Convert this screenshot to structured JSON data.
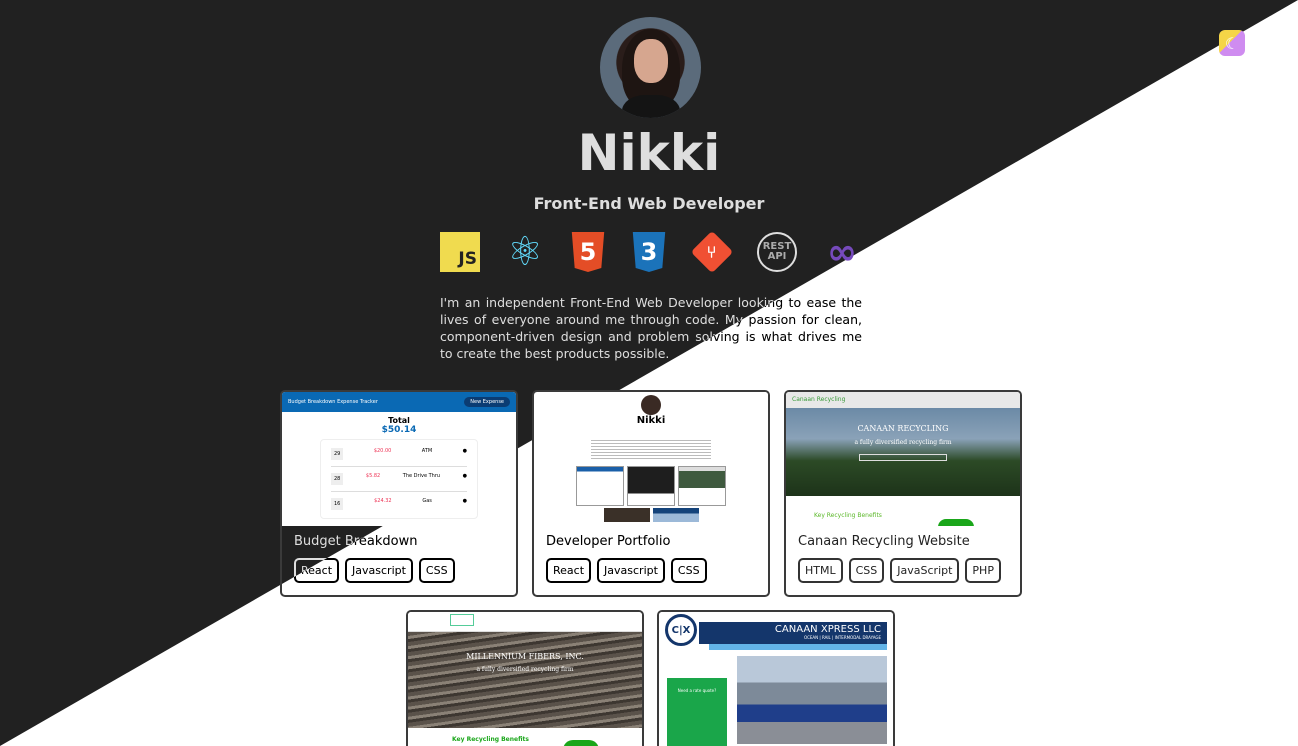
{
  "profile": {
    "name": "Nikki",
    "role": "Front-End Web Developer",
    "bio": "I'm an independent Front-End Web Developer looking to ease the lives of everyone around me through code. My passion for clean, component-driven design and problem solving is what drives me to create the best products possible."
  },
  "skills": [
    {
      "icon": "javascript-icon",
      "label": "JS"
    },
    {
      "icon": "react-icon",
      "label": "⚛"
    },
    {
      "icon": "html5-icon",
      "label": "5"
    },
    {
      "icon": "css3-icon",
      "label": "3"
    },
    {
      "icon": "git-icon",
      "label": "⑂"
    },
    {
      "icon": "rest-api-icon",
      "label": "REST API"
    },
    {
      "icon": "redux-icon",
      "label": "∞"
    }
  ],
  "theme_toggle": {
    "icon": "moon-icon",
    "glyph": "☾"
  },
  "colors": {
    "dark_bg": "#212121",
    "light_bg": "#ffffff",
    "accent_blue": "#0a69b4",
    "accent_green": "#1fa34a"
  },
  "projects": [
    {
      "title": "Budget Breakdown",
      "tags": [
        "React",
        "Javascript",
        "CSS"
      ],
      "thumb": {
        "header": "Budget Breakdown Expense Tracker",
        "button": "New Expense",
        "total_label": "Total",
        "total": "$50.14",
        "rows": [
          {
            "amount": "$20.00",
            "desc": "ATM"
          },
          {
            "amount": "$5.82",
            "desc": "The Drive Thru"
          },
          {
            "amount": "$24.32",
            "desc": "Gas"
          }
        ]
      }
    },
    {
      "title": "Developer Portfolio",
      "tags": [
        "React",
        "Javascript",
        "CSS"
      ],
      "thumb": {
        "name": "Nikki"
      }
    },
    {
      "title": "Canaan Recycling Website",
      "tags": [
        "HTML",
        "CSS",
        "JavaScript",
        "PHP"
      ],
      "thumb": {
        "heading": "CANAAN RECYCLING",
        "sub": "a fully diversified recycling firm",
        "benefits": "Key Recycling Benefits",
        "logo": "Canaan Recycling"
      }
    },
    {
      "thumb": {
        "heading": "MILLENNIUM FIBERS, INC.",
        "sub": "a fully diversified recycling firm",
        "benefits": "Key Recycling Benefits"
      }
    },
    {
      "thumb": {
        "logo": "C|X",
        "heading": "CANAAN XPRESS LLC",
        "sub": "OCEAN | RAIL | INTERMODAL DRAYAGE",
        "cta": "Need a rate quote?"
      }
    }
  ]
}
